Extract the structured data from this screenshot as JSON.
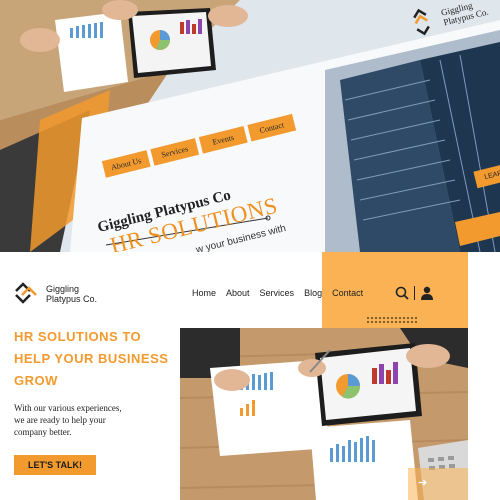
{
  "top_preview": {
    "nav": [
      "About Us",
      "Services",
      "Events",
      "Contact"
    ],
    "brand": "Giggling Platypus Co",
    "hero_title": "HR SOLUTIONS",
    "subtitle_fragment": "w your business with",
    "learn_more": "LEARN M",
    "logo_text_line1": "Giggling",
    "logo_text_line2": "Platypus Co."
  },
  "header": {
    "logo_line1": "Giggling",
    "logo_line2": "Platypus Co.",
    "nav": [
      "Home",
      "About",
      "Services",
      "Blog",
      "Contact"
    ]
  },
  "hero": {
    "headline_line1": "HR SOLUTIONS TO",
    "headline_line2": "HELP YOUR BUSINESS",
    "headline_line3": "GROW",
    "body_line1": "With our various experiences,",
    "body_line2": "we are ready to help your",
    "body_line3": "company better.",
    "cta": "LET'S TALK!"
  },
  "icons": {
    "search": "search-icon",
    "user": "user-icon",
    "arrow": "arrow-right-icon",
    "logo": "logo-icon"
  },
  "colors": {
    "accent": "#f29a2e",
    "accent_light": "#fbb254",
    "text": "#222222"
  }
}
